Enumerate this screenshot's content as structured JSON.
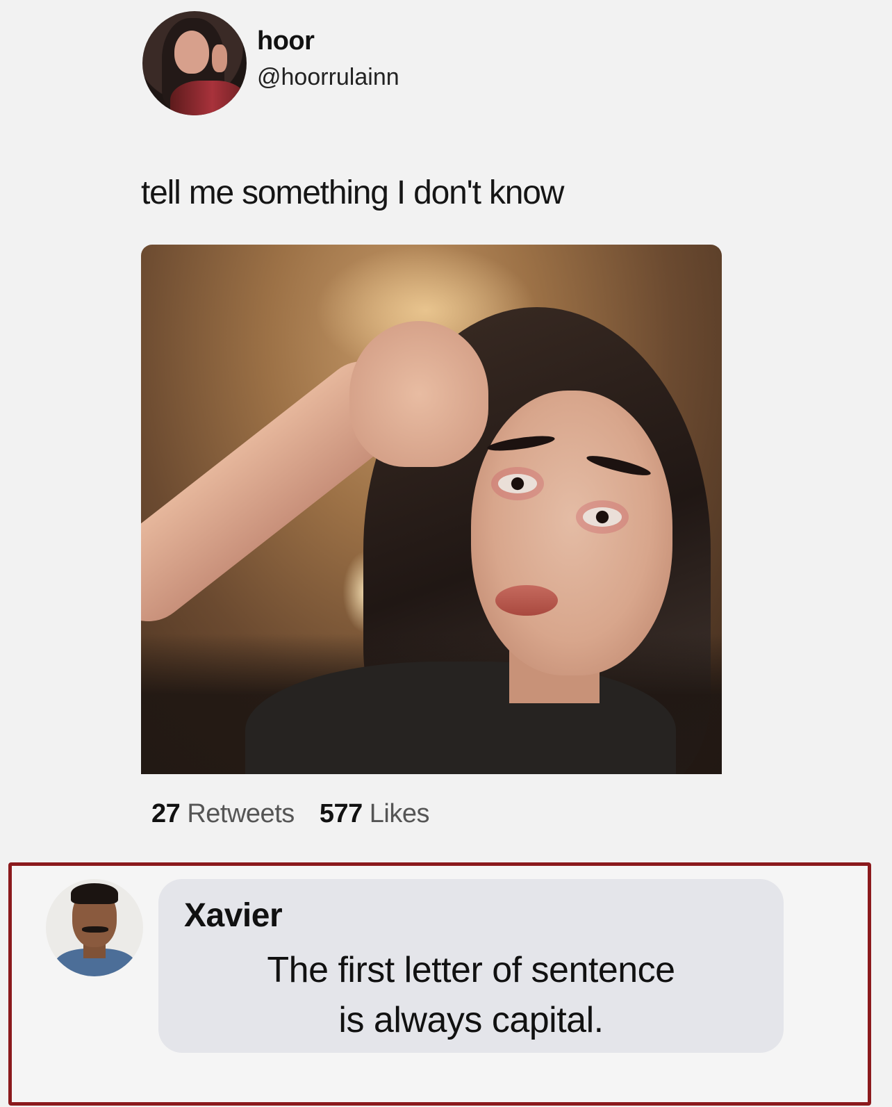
{
  "tweet": {
    "author": {
      "display_name": "hoor",
      "handle": "@hoorrulainn"
    },
    "text": "tell me something I don't know",
    "stats": {
      "retweets_count": "27",
      "retweets_label": "Retweets",
      "likes_count": "577",
      "likes_label": "Likes"
    }
  },
  "comment": {
    "author": "Xavier",
    "text_line1": "The first letter of sentence",
    "text_line2": "is always capital."
  },
  "colors": {
    "page_background": "#f2f2f2",
    "highlight_frame": "#8b1a1d",
    "comment_bubble": "#e4e5ea"
  }
}
